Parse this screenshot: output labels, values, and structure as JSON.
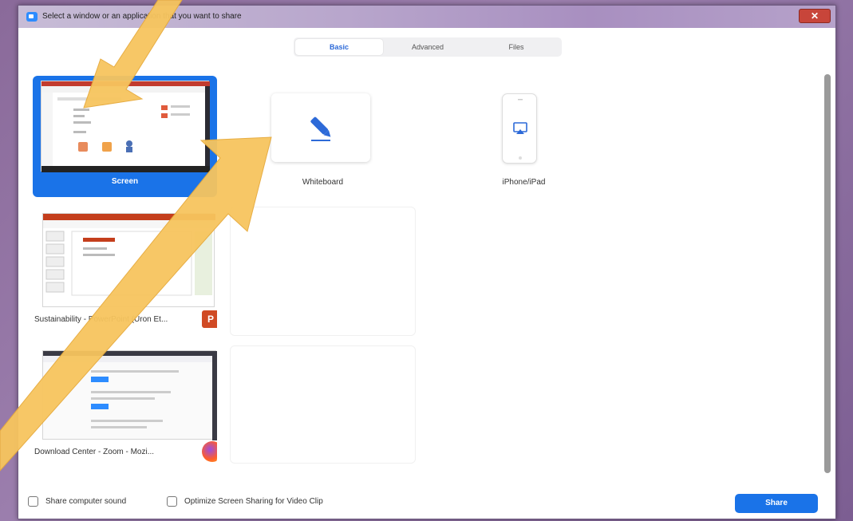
{
  "window": {
    "title": "Select a window or an application that you want to share",
    "close_glyph": "✕"
  },
  "tabs": [
    {
      "label": "Basic",
      "active": true
    },
    {
      "label": "Advanced",
      "active": false
    },
    {
      "label": "Files",
      "active": false
    }
  ],
  "sources": {
    "screen": {
      "label": "Screen",
      "selected": true
    },
    "powerpoint": {
      "label": "Sustainability - PowerPoint (Uron Et...",
      "icon": "powerpoint-icon",
      "icon_letter": "P"
    },
    "firefox": {
      "label": "Download Center - Zoom - Mozi...",
      "icon": "firefox-icon"
    }
  },
  "options": {
    "whiteboard": {
      "label": "Whiteboard",
      "icon": "pencil-icon"
    },
    "iphone": {
      "label": "iPhone/iPad",
      "icon": "airplay-icon"
    }
  },
  "footer": {
    "share_sound": "Share computer sound",
    "optimize_video": "Optimize Screen Sharing for Video Clip",
    "share_button": "Share"
  },
  "colors": {
    "accent": "#1a73e8",
    "arrow": "#f7c55e"
  }
}
